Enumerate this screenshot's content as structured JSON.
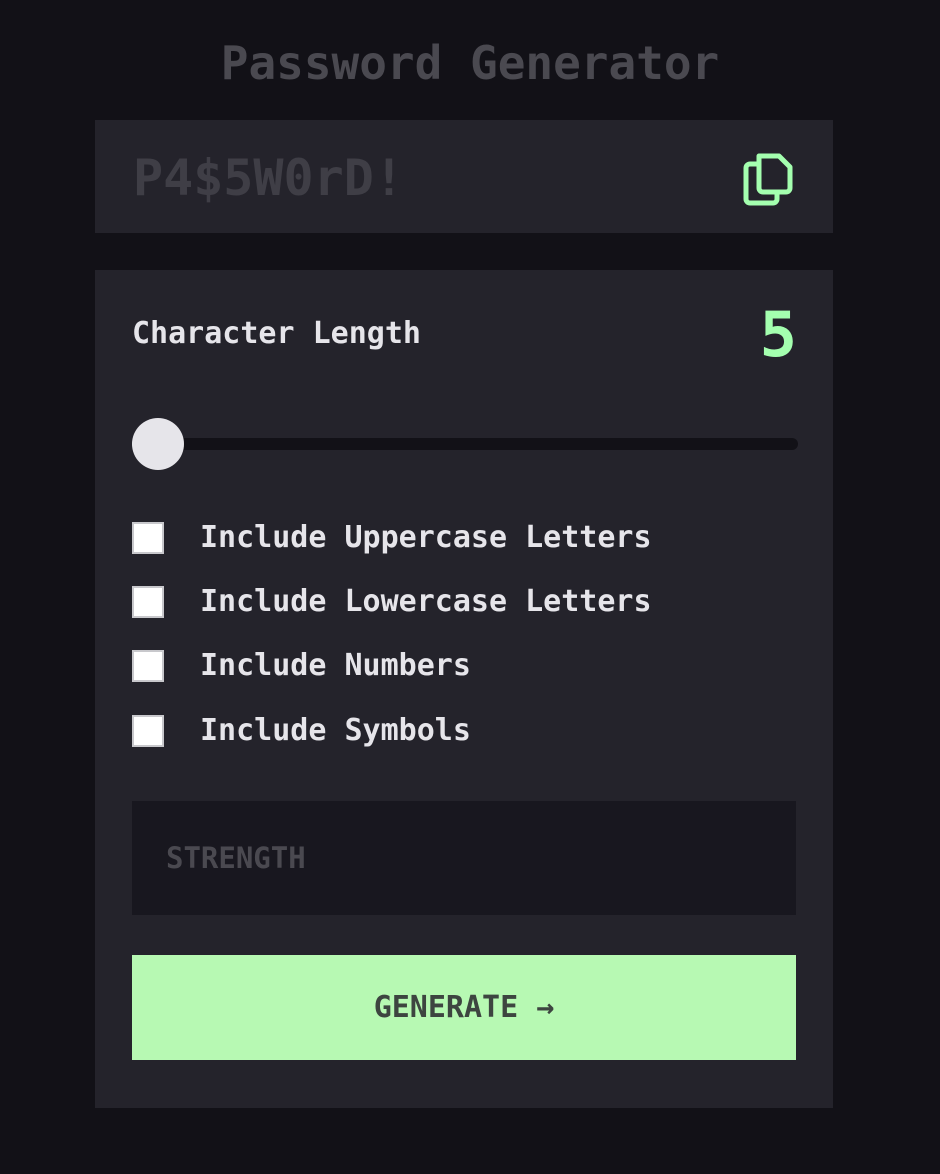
{
  "app": {
    "title": "Password Generator"
  },
  "display": {
    "password_placeholder": "P4$5W0rD!",
    "copy_icon": "copy-icon"
  },
  "length": {
    "label": "Character Length",
    "value": "5",
    "slider": {
      "min": 0,
      "max": 20,
      "value": 0
    }
  },
  "options": [
    {
      "label": "Include Uppercase Letters",
      "checked": false
    },
    {
      "label": "Include Lowercase Letters",
      "checked": false
    },
    {
      "label": "Include Numbers",
      "checked": false
    },
    {
      "label": "Include Symbols",
      "checked": false
    }
  ],
  "strength": {
    "label": "STRENGTH"
  },
  "generate": {
    "label": "GENERATE →"
  },
  "colors": {
    "background": "#121117",
    "panel": "#24232b",
    "accent": "#a4ffaf",
    "button": "#b7f9b3",
    "text": "#e6e5ea",
    "muted": "#4a4950"
  }
}
